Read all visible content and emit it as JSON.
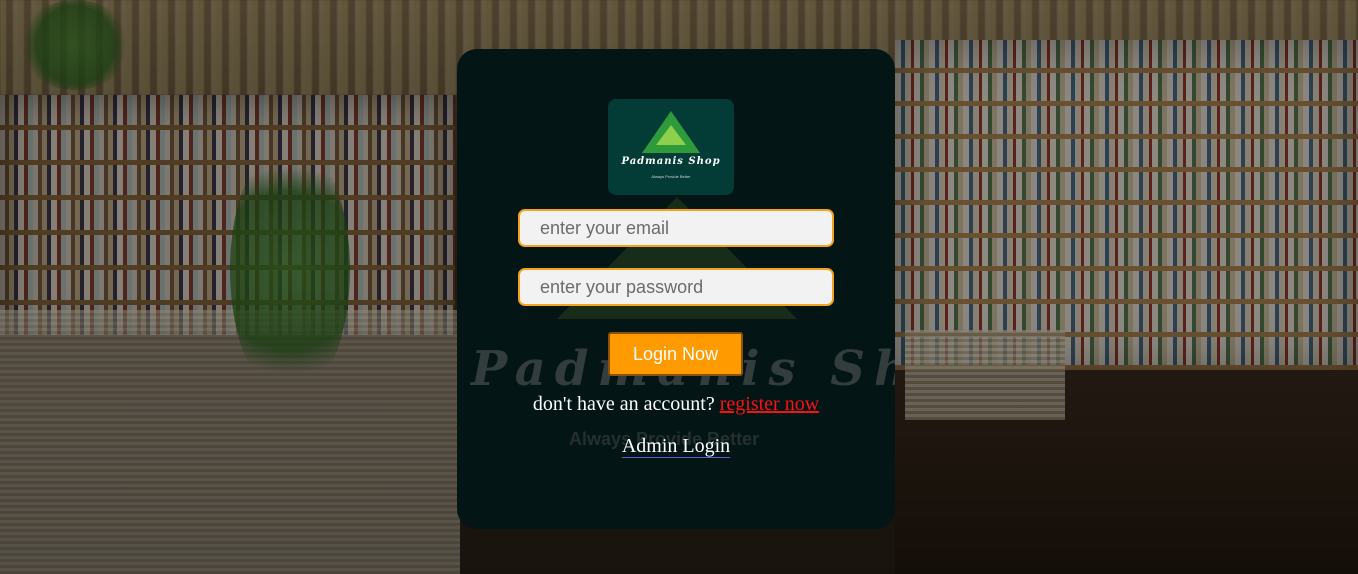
{
  "brand": {
    "logo_name": "Padmanis Shop",
    "logo_tagline": "Always Provide Better",
    "watermark_name": "Padmanis Shop",
    "watermark_tagline": "Always Provide Better"
  },
  "login_form": {
    "email_placeholder": "enter your email",
    "email_value": "",
    "password_placeholder": "enter your password",
    "password_value": "",
    "submit_label": "Login Now",
    "register_prompt": "don't have an account?",
    "register_link": "register now",
    "admin_link": "Admin Login"
  },
  "colors": {
    "card_background": "#041516",
    "field_border": "#f5a31a",
    "button_background": "#ff9a00",
    "register_link": "#ff1010",
    "logo_background": "#033c36"
  },
  "icons": {
    "logo": "green-triangle-logo-icon"
  }
}
